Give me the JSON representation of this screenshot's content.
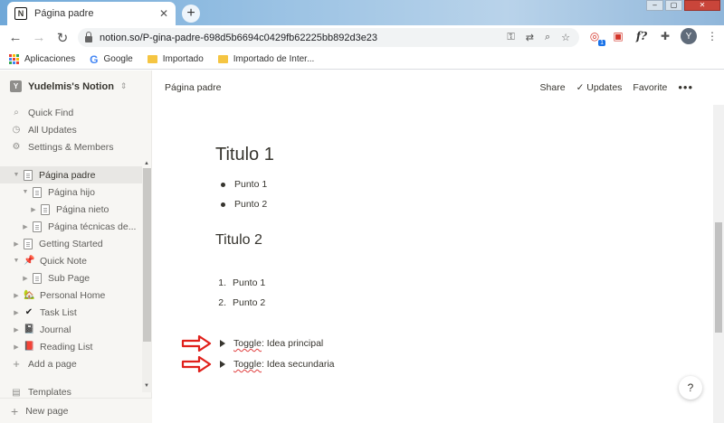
{
  "browser": {
    "tab_title": "Página padre",
    "tab_favicon": "N",
    "tab_close": "✕",
    "newtab": "+",
    "window_controls": [
      "–",
      "▢",
      "✕"
    ],
    "url": "notion.so/P-gina-padre-698d5b6694c0429fb62225bb892d3e23",
    "ext_badge": "1",
    "ext_fx_label": "f?",
    "profile_initial": "Y",
    "bookmarks": [
      "Aplicaciones",
      "Google",
      "Importado",
      "Importado de Inter..."
    ]
  },
  "sidebar": {
    "workspace_initial": "Y",
    "workspace_name": "Yudelmis's Notion",
    "workspace_chevron": "⌃⌄",
    "menu": [
      "Quick Find",
      "All Updates",
      "Settings & Members"
    ],
    "pages": [
      {
        "label": "Página padre",
        "caret": "▼",
        "icon": "page"
      },
      {
        "label": "Página hijo",
        "caret": "▼",
        "icon": "page"
      },
      {
        "label": "Página nieto",
        "caret": "▶",
        "icon": "page"
      },
      {
        "label": "Página técnicas de...",
        "caret": "▶",
        "icon": "page"
      },
      {
        "label": "Getting Started",
        "caret": "▶",
        "icon": "page"
      },
      {
        "label": "Quick Note",
        "caret": "▼",
        "icon": "📌"
      },
      {
        "label": "Sub Page",
        "caret": "▶",
        "icon": "page"
      },
      {
        "label": "Personal Home",
        "caret": "▶",
        "icon": "🏡"
      },
      {
        "label": "Task List",
        "caret": "▶",
        "icon": "✔"
      },
      {
        "label": "Journal",
        "caret": "▶",
        "icon": "📓"
      },
      {
        "label": "Reading List",
        "caret": "▶",
        "icon": "📕"
      }
    ],
    "add_page": "Add a page",
    "templates_partial": "Templates",
    "new_page": "New page"
  },
  "topbar": {
    "breadcrumb": "Página padre",
    "share": "Share",
    "updates": "Updates",
    "favorite": "Favorite",
    "more": "•••"
  },
  "document": {
    "heading1": "Titulo 1",
    "bullets": [
      "Punto 1",
      "Punto 2"
    ],
    "heading2": "Titulo 2",
    "numbered": [
      {
        "num": "1.",
        "text": "Punto 1"
      },
      {
        "num": "2.",
        "text": "Punto 2"
      }
    ],
    "toggles": [
      {
        "keyword": "Toggle",
        "rest": ": Idea principal"
      },
      {
        "keyword": "Toggle",
        "rest": ": Idea secundaria"
      }
    ]
  },
  "help": "?",
  "colors": {
    "arrow_red": "#e0201b",
    "sidebar_bg": "#f7f6f3",
    "text": "#37352f"
  }
}
